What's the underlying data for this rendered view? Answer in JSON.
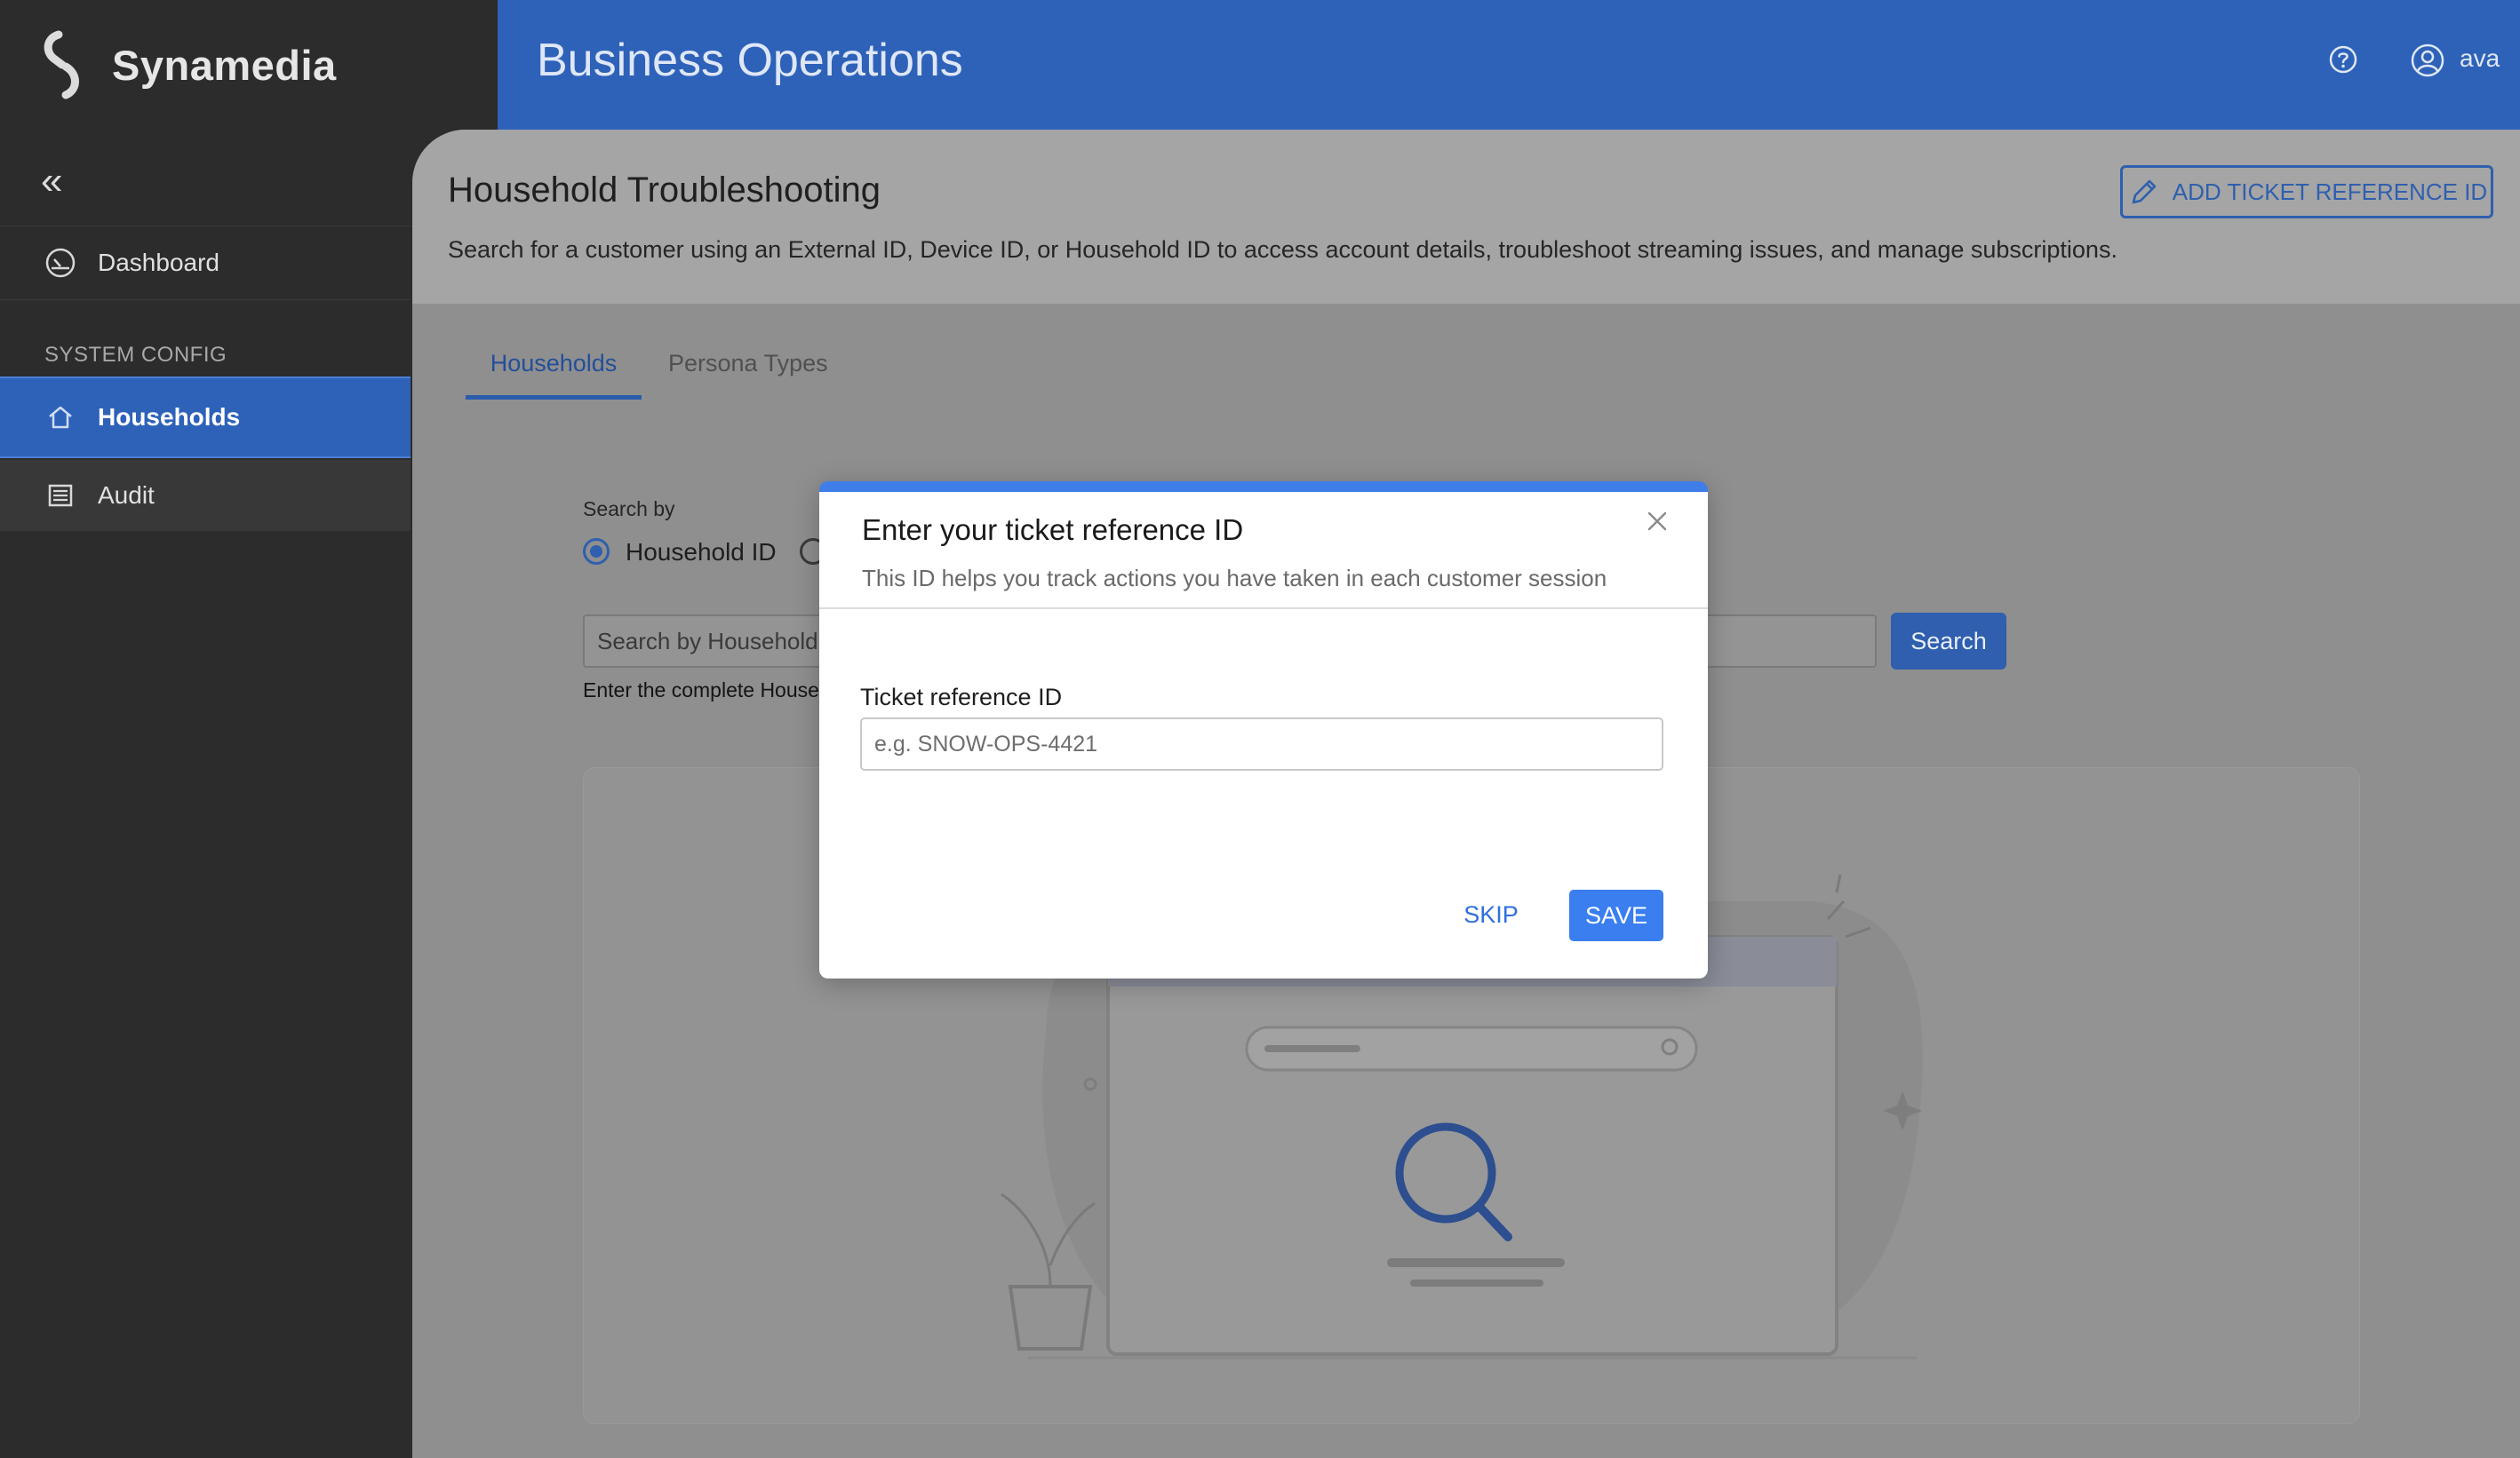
{
  "brand": {
    "name": "Synamedia"
  },
  "header": {
    "title": "Business Operations",
    "user": "ava"
  },
  "sidebar": {
    "collapse_icon": "double-chevron-left-icon",
    "section_label": "SYSTEM CONFIG",
    "items": [
      {
        "label": "Dashboard",
        "icon": "gauge-icon"
      },
      {
        "label": "Households",
        "icon": "home-icon",
        "active": true
      },
      {
        "label": "Audit",
        "icon": "list-icon"
      }
    ]
  },
  "page": {
    "title": "Household Troubleshooting",
    "description": "Search for a customer using an External ID, Device ID, or Household ID to access account details, troubleshoot streaming issues, and manage subscriptions.",
    "add_ticket_label": "ADD TICKET REFERENCE ID"
  },
  "tabs": [
    {
      "label": "Households",
      "active": true
    },
    {
      "label": "Persona Types",
      "active": false
    }
  ],
  "search": {
    "by_label": "Search by",
    "selected_option": "Household ID",
    "placeholder": "Search by Household I",
    "button_label": "Search",
    "hint": "Enter the complete Househ"
  },
  "modal": {
    "title": "Enter your ticket reference ID",
    "subtitle": "This ID helps you track actions you have taken in each customer session",
    "field_label": "Ticket reference ID",
    "field_placeholder": "e.g. SNOW-OPS-4421",
    "field_value": "",
    "skip_label": "SKIP",
    "save_label": "SAVE"
  },
  "colors": {
    "accent": "#2e62b9",
    "modal_accent": "#3f7ee8",
    "sidebar_bg": "#2c2c2c"
  }
}
